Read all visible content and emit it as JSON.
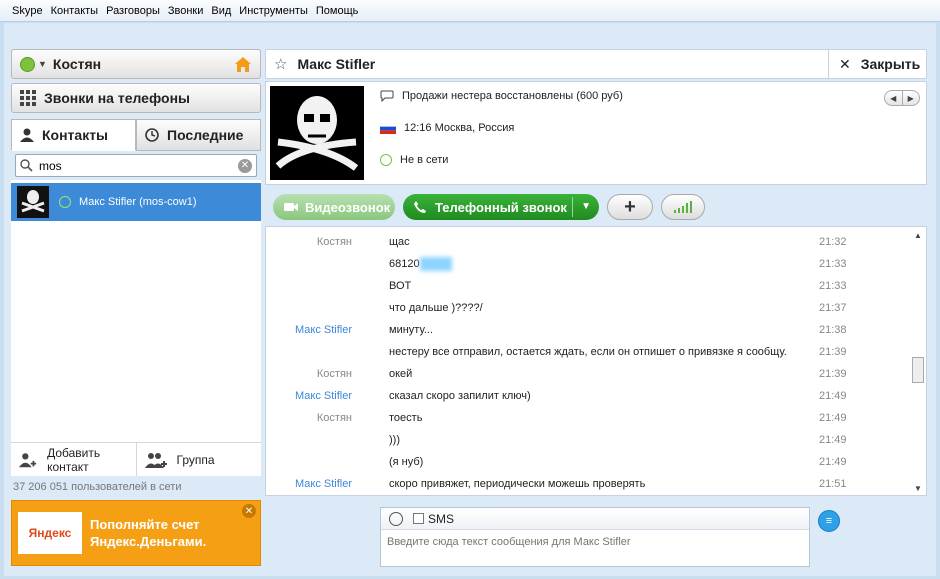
{
  "menu": [
    "Skype",
    "Контакты",
    "Разговоры",
    "Звонки",
    "Вид",
    "Инструменты",
    "Помощь"
  ],
  "user": {
    "name": "Костян"
  },
  "left": {
    "phones_label": "Звонки на телефоны",
    "tabs": {
      "contacts": "Контакты",
      "recent": "Последние"
    },
    "search": {
      "value": "mos",
      "placeholder": ""
    },
    "contacts": [
      {
        "name": "Макс Stifler (mos-cow1)"
      }
    ],
    "add_contact": "Добавить контакт",
    "group": "Группа",
    "users_online": "37 206 051 пользователей в сети",
    "ad": {
      "logo": "Яндекс",
      "line1": "Пополняйте счет",
      "line2": "Яндекс.Деньгами."
    }
  },
  "chat_header": {
    "title": "Макс Stifler",
    "close": "Закрыть"
  },
  "profile": {
    "mood": "Продажи нестера восстановлены (600 руб)",
    "location": "12:16 Москва, Россия",
    "status": "Не в сети"
  },
  "calls": {
    "video": "Видеозвонок",
    "phone": "Телефонный звонок"
  },
  "messages": [
    {
      "who": "Костян",
      "text": "щас",
      "time": "21:32",
      "other": false
    },
    {
      "who": "",
      "text": "68120",
      "time": "21:33",
      "other": false,
      "blur": true
    },
    {
      "who": "",
      "text": "ВОТ",
      "time": "21:33",
      "other": false
    },
    {
      "who": "",
      "text": "что дальше )????/",
      "time": "21:37",
      "other": false
    },
    {
      "who": "Макс Stifler",
      "text": "минуту...",
      "time": "21:38",
      "other": true
    },
    {
      "who": "",
      "text": "нестеру все отправил, остается ждать, если он отпишет о привязке я сообщу.",
      "time": "21:39",
      "other": true
    },
    {
      "who": "Костян",
      "text": "окей",
      "time": "21:39",
      "other": false
    },
    {
      "who": "Макс Stifler",
      "text": "сказал скоро запилит ключ)",
      "time": "21:49",
      "other": true
    },
    {
      "who": "Костян",
      "text": "тоесть",
      "time": "21:49",
      "other": false
    },
    {
      "who": "",
      "text": ")))",
      "time": "21:49",
      "other": false
    },
    {
      "who": "",
      "text": "(я нуб)",
      "time": "21:49",
      "other": false
    },
    {
      "who": "Макс Stifler",
      "text": "скоро привяжет, периодически можешь проверять",
      "time": "21:51",
      "other": true
    }
  ],
  "compose": {
    "sms": "SMS",
    "placeholder": "Введите сюда текст сообщения для Макс Stifler"
  },
  "colors": {
    "accent": "#3d8ad9",
    "green": "#2aa12a",
    "ad": "#f5a014"
  }
}
